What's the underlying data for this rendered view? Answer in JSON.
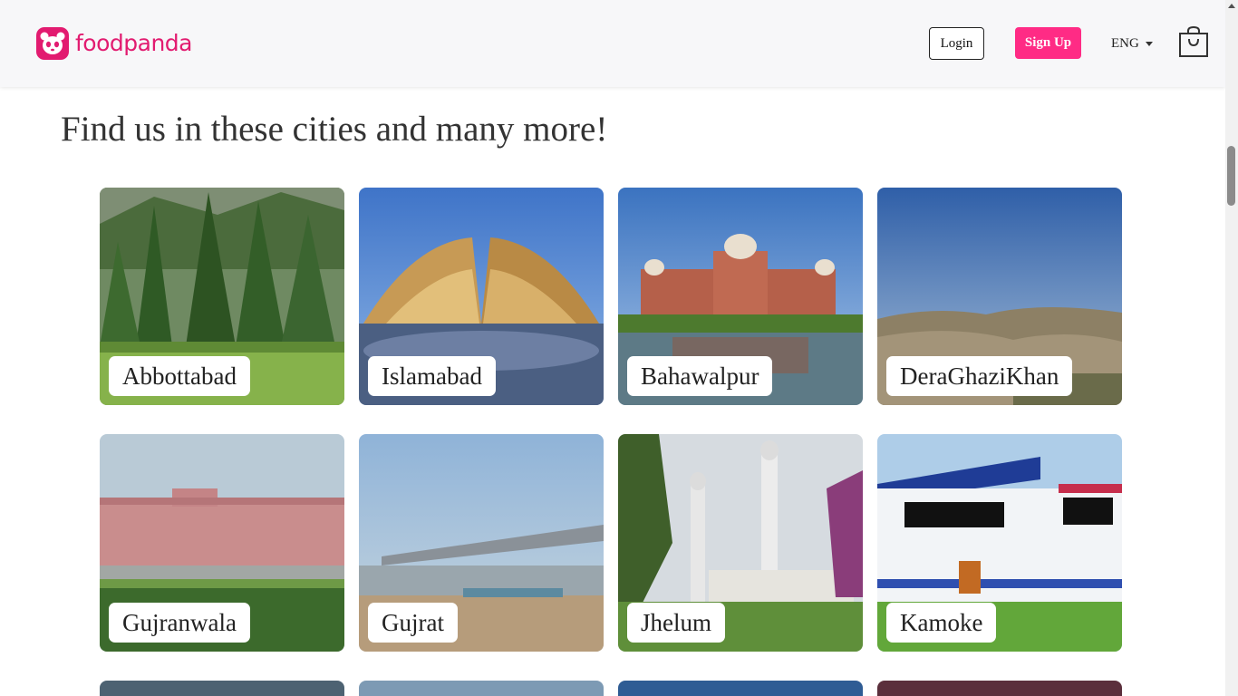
{
  "header": {
    "brand": "foodpanda",
    "login_label": "Login",
    "signup_label": "Sign Up",
    "language": "ENG",
    "cart_icon": "shopping-bag-icon",
    "brand_color": "#e21b70",
    "signup_color": "#ff2b85"
  },
  "main": {
    "title": "Find us in these cities and many more!",
    "cities": [
      {
        "name": "Abbottabad"
      },
      {
        "name": "Islamabad"
      },
      {
        "name": "Bahawalpur"
      },
      {
        "name": "DeraGhaziKhan"
      },
      {
        "name": "Gujranwala"
      },
      {
        "name": "Gujrat"
      },
      {
        "name": "Jhelum"
      },
      {
        "name": "Kamoke"
      }
    ]
  }
}
